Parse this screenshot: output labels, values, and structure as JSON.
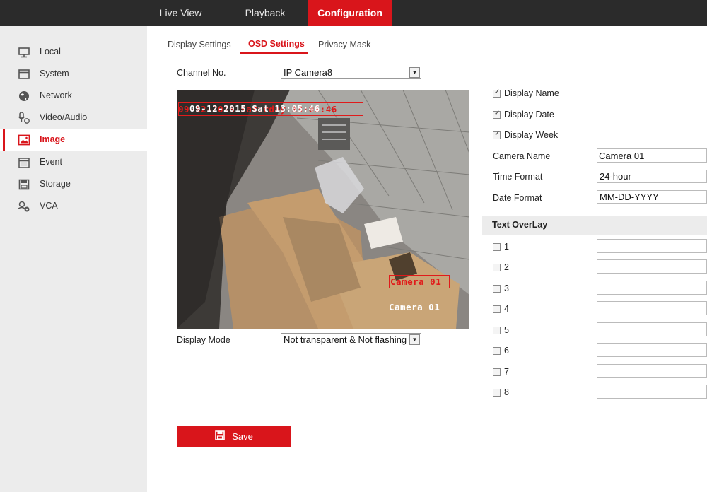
{
  "topnav": {
    "items": [
      {
        "label": "Live View",
        "active": false
      },
      {
        "label": "Playback",
        "active": false
      },
      {
        "label": "Configuration",
        "active": true
      }
    ]
  },
  "sidebar": {
    "items": [
      {
        "label": "Local",
        "icon": "monitor-icon"
      },
      {
        "label": "System",
        "icon": "window-icon"
      },
      {
        "label": "Network",
        "icon": "globe-icon"
      },
      {
        "label": "Video/Audio",
        "icon": "microphone-icon"
      },
      {
        "label": "Image",
        "icon": "image-icon",
        "active": true
      },
      {
        "label": "Event",
        "icon": "calendar-icon"
      },
      {
        "label": "Storage",
        "icon": "disk-icon"
      },
      {
        "label": "VCA",
        "icon": "vca-icon"
      }
    ]
  },
  "tabs": [
    {
      "label": "Display Settings",
      "active": false
    },
    {
      "label": "OSD Settings",
      "active": true
    },
    {
      "label": "Privacy Mask",
      "active": false
    }
  ],
  "channel": {
    "label": "Channel No.",
    "value": "IP Camera8"
  },
  "preview": {
    "date_osd": "09-12-2015 Sat 13:05:46",
    "date_osd_overlap": "09-12-2015 Saturday 13:05:46",
    "name_osd": "Camera 01",
    "name_osd_overlap": "Camera 01"
  },
  "display_mode": {
    "label": "Display Mode",
    "value": "Not transparent & Not flashing"
  },
  "options": {
    "display_name": {
      "label": "Display Name",
      "checked": true
    },
    "display_date": {
      "label": "Display Date",
      "checked": true
    },
    "display_week": {
      "label": "Display Week",
      "checked": true
    }
  },
  "fields": {
    "camera_name": {
      "label": "Camera Name",
      "value": "Camera 01"
    },
    "time_format": {
      "label": "Time Format",
      "value": "24-hour"
    },
    "date_format": {
      "label": "Date Format",
      "value": "MM-DD-YYYY"
    }
  },
  "overlay": {
    "title": "Text OverLay",
    "items": [
      {
        "label": "1",
        "checked": false,
        "value": ""
      },
      {
        "label": "2",
        "checked": false,
        "value": ""
      },
      {
        "label": "3",
        "checked": false,
        "value": ""
      },
      {
        "label": "4",
        "checked": false,
        "value": ""
      },
      {
        "label": "5",
        "checked": false,
        "value": ""
      },
      {
        "label": "6",
        "checked": false,
        "value": ""
      },
      {
        "label": "7",
        "checked": false,
        "value": ""
      },
      {
        "label": "8",
        "checked": false,
        "value": ""
      }
    ]
  },
  "save": {
    "label": "Save",
    "icon": "floppy-icon"
  },
  "colors": {
    "accent": "#d9151b",
    "topbar": "#2b2b2b",
    "sidebar": "#ececec"
  }
}
